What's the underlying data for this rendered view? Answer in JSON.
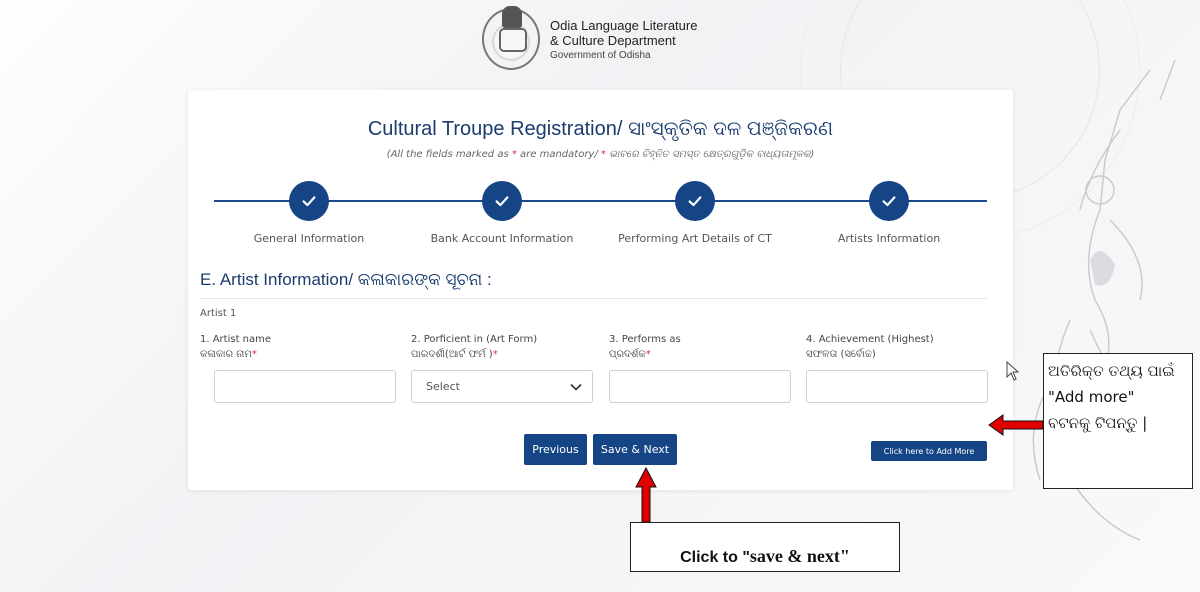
{
  "header": {
    "org_line1": "Odia Language Literature",
    "org_line2": "& Culture Department",
    "org_line3": "Government of Odisha"
  },
  "form": {
    "title": "Cultural Troupe Registration/ ସାଂସ୍କୃତିକ ଦଳ ପଞ୍ଜିକରଣ",
    "subtitle_prefix": "(All the fields marked as ",
    "subtitle_star": "*",
    "subtitle_mid": " are mandatory/ ",
    "subtitle_star2": "*",
    "subtitle_suffix": " ଭାବରେ ଚିହ୍ନିତ ସମସ୍ତ କ୍ଷେତ୍ରଗୁଡ଼ିକ ବାଧ୍ୟତାମୂଳକ)",
    "steps": [
      {
        "label": "General Information",
        "done": true
      },
      {
        "label": "Bank Account Information",
        "done": true
      },
      {
        "label": "Performing Art Details of CT",
        "done": true
      },
      {
        "label": "Artists Information",
        "done": true
      }
    ],
    "section_title": "E. Artist Information/ କଳାକାରଙ୍କ ସୂଚନା :",
    "artist_label": "Artist 1",
    "fields": [
      {
        "label": "1. Artist name",
        "sub": "କଳାକାର ନାମ",
        "required": true,
        "value": "",
        "type": "text"
      },
      {
        "label": "2. Porficient in (Art Form)",
        "sub": "ପାରଦର୍ଶୀ(ଆର୍ଟ ଫର୍ମ )",
        "required": true,
        "value": "Select",
        "type": "select"
      },
      {
        "label": "3. Performs as",
        "sub": "ପ୍ରଦର୍ଶକ",
        "required": true,
        "value": "",
        "type": "text"
      },
      {
        "label": "4. Achievement (Highest)",
        "sub": "ସଫଳତା (ସର୍ବୋଚ୍ଚ)",
        "required": false,
        "value": "",
        "type": "text"
      }
    ],
    "required_mark": "*",
    "add_more_label": "Click here to Add More",
    "previous_label": "Previous",
    "save_next_label": "Save & Next"
  },
  "annotations": {
    "right_line1": "ଅତିରିକ୍ତ ତଥ୍ୟ ପାଇଁ",
    "right_line2": "\"Add more\"",
    "right_line3": "ବଟନକୁ ଟିପନ୍ତୁ |",
    "bottom_part1": "Click to \"",
    "bottom_part2": "save & next\"",
    "arrow_color": "#e00000"
  },
  "colors": {
    "primary": "#164585",
    "title": "#1a3c6e",
    "required": "#d0342c"
  }
}
